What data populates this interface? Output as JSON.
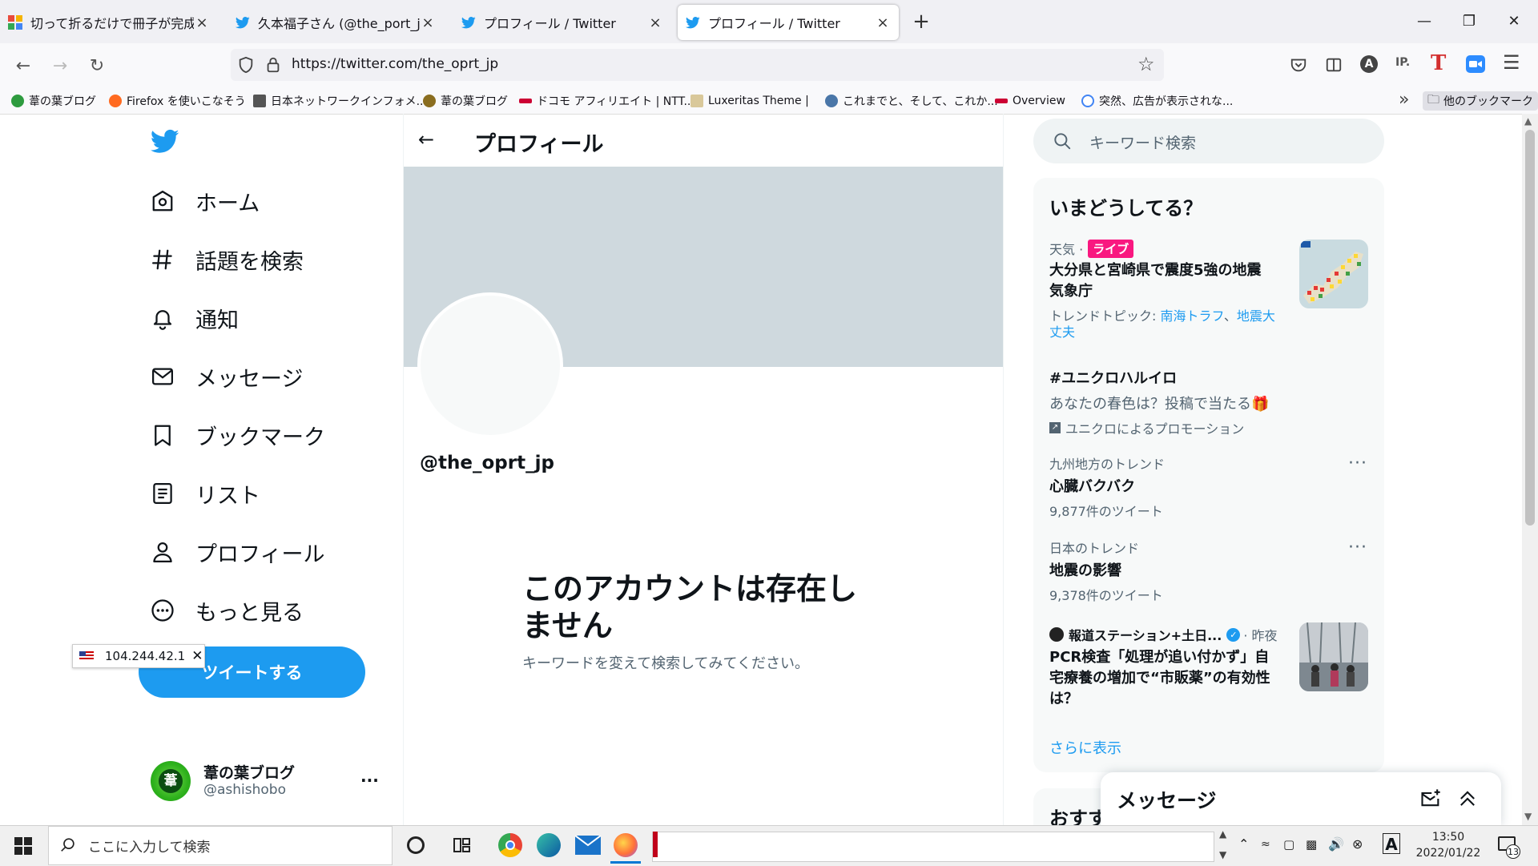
{
  "browser": {
    "tabs": [
      {
        "title": "切って折るだけで冊子が完成！コ",
        "close": "×"
      },
      {
        "title": "久本福子さん (@the_port_jp) / Tw",
        "close": "×"
      },
      {
        "title": "プロフィール / Twitter",
        "close": "×"
      },
      {
        "title": "プロフィール / Twitter",
        "close": "×"
      }
    ],
    "new_tab": "+",
    "url": "https://twitter.com/the_oprt_jp",
    "bookmarks": [
      {
        "label": "葦の葉ブログ",
        "color": "#2e9b3f"
      },
      {
        "label": "Firefox を使いこなそう",
        "color": "#ff6a20"
      },
      {
        "label": "日本ネットワークインフォメ...",
        "color": "#555555"
      },
      {
        "label": "葦の葉ブログ",
        "color": "#8a6d1f"
      },
      {
        "label": "ドコモ アフィリエイト | NTT...",
        "color": "#cc0033"
      },
      {
        "label": "Luxeritas Theme |",
        "color": "#d9c89a"
      },
      {
        "label": "これまでと、そして、これか...",
        "color": "#4a76a8"
      },
      {
        "label": "Overview",
        "color": "#cc0033"
      },
      {
        "label": "突然、広告が表示されな...",
        "color": "#4285f4"
      }
    ],
    "overflow": "»",
    "other_bookmarks": "他のブックマーク"
  },
  "sidebar": {
    "items": [
      {
        "label": "ホーム",
        "icon": "home-icon"
      },
      {
        "label": "話題を検索",
        "icon": "hashtag-icon"
      },
      {
        "label": "通知",
        "icon": "bell-icon"
      },
      {
        "label": "メッセージ",
        "icon": "mail-icon"
      },
      {
        "label": "ブックマーク",
        "icon": "bookmark-icon"
      },
      {
        "label": "リスト",
        "icon": "list-icon"
      },
      {
        "label": "プロフィール",
        "icon": "person-icon"
      },
      {
        "label": "もっと見る",
        "icon": "more-circle-icon"
      }
    ],
    "tweet_button": "ツイートする",
    "ip_chip": "104.244.42.1",
    "account": {
      "name": "葦の葉ブログ",
      "handle": "@ashishobo",
      "avatar_char": "葦",
      "more": "···"
    }
  },
  "profile": {
    "header_title": "プロフィール",
    "handle": "@the_oprt_jp",
    "empty_title_line1": "このアカウントは存在し",
    "empty_title_line2": "ません",
    "empty_subtitle": "キーワードを変えて検索してみてください。"
  },
  "right": {
    "search_placeholder": "キーワード検索",
    "trends_title": "いまどうしてる？",
    "trend1": {
      "category": "天気 ·",
      "badge": "ライブ",
      "title_line1": "大分県と宮崎県で震度5強の地震",
      "title_line2": "気象庁",
      "topics_prefix": "トレンドトピック:",
      "topic1": "南海トラフ",
      "sep": "、",
      "topic2_line1": "地震大",
      "topic2_line2": "丈夫"
    },
    "trend2": {
      "title": "#ユニクロハルイロ",
      "desc": "あなたの春色は？投稿で当たる🎁",
      "promo": "ユニクロによるプロモーション"
    },
    "trend3": {
      "category": "九州地方のトレンド",
      "title": "心臓バクバク",
      "count": "9,877件のツイート"
    },
    "trend4": {
      "category": "日本のトレンド",
      "title": "地震の影響",
      "count": "9,378件のツイート"
    },
    "trend5": {
      "source": "報道ステーション+土日...",
      "time": "· 昨夜",
      "title_line1": "PCR検査「処理が追い付かず」自",
      "title_line2": "宅療養の増加で“市販薬”の有効性",
      "title_line3": "は？"
    },
    "show_more": "さらに表示",
    "next_section": "おすす"
  },
  "messages_drawer": {
    "title": "メッセージ"
  },
  "taskbar": {
    "search_placeholder": "ここに入力して検索",
    "time": "13:50",
    "date": "2022/01/22",
    "notif_count": "13"
  },
  "colors": {
    "twitter_blue": "#1d9bf0",
    "banner": "#cfd9de",
    "live_badge": "#f91880"
  }
}
